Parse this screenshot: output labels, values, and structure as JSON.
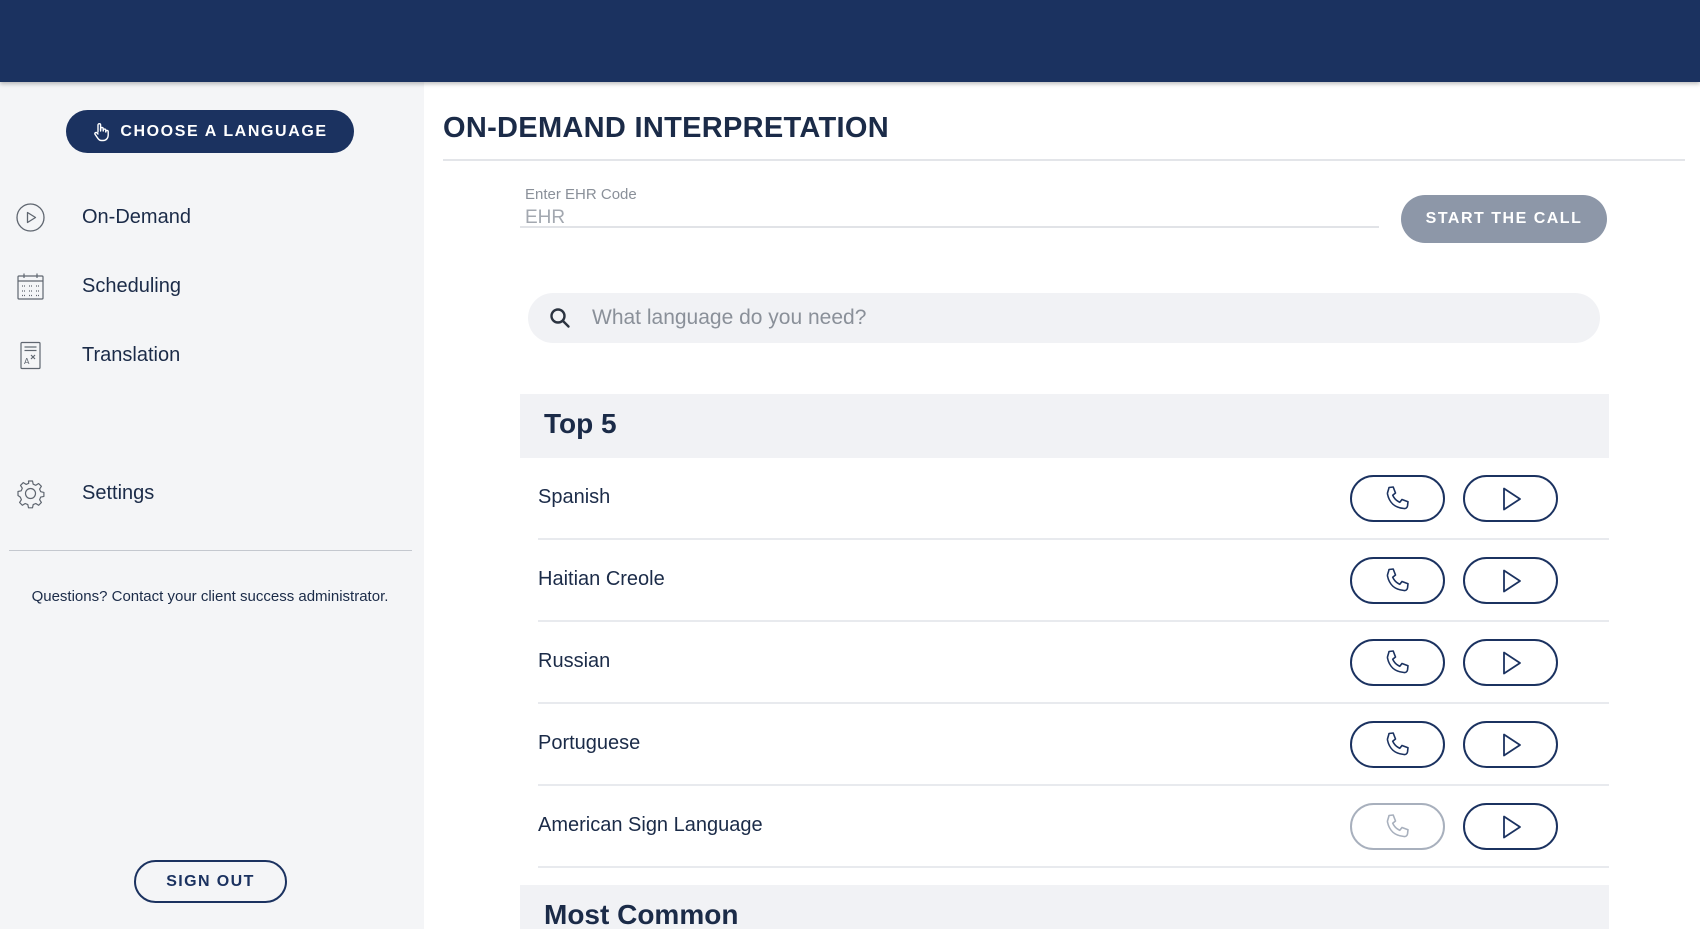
{
  "sidebar": {
    "choose_language_label": "CHOOSE A LANGUAGE",
    "nav": [
      {
        "label": "On-Demand",
        "icon": "play-circle-icon"
      },
      {
        "label": "Scheduling",
        "icon": "calendar-icon"
      },
      {
        "label": "Translation",
        "icon": "document-translate-icon"
      },
      {
        "label": "Settings",
        "icon": "gear-icon"
      }
    ],
    "questions_text": "Questions? Contact your client success administrator.",
    "sign_out_label": "SIGN OUT"
  },
  "main": {
    "title": "ON-DEMAND INTERPRETATION",
    "ehr": {
      "label": "Enter EHR Code",
      "placeholder": "EHR",
      "value": ""
    },
    "start_call_label": "START THE CALL",
    "search": {
      "placeholder": "What language do you need?",
      "value": ""
    },
    "sections": [
      {
        "title": "Top 5",
        "languages": [
          {
            "name": "Spanish",
            "audio_enabled": true,
            "video_enabled": true
          },
          {
            "name": "Haitian Creole",
            "audio_enabled": true,
            "video_enabled": true
          },
          {
            "name": "Russian",
            "audio_enabled": true,
            "video_enabled": true
          },
          {
            "name": "Portuguese",
            "audio_enabled": true,
            "video_enabled": true
          },
          {
            "name": "American Sign Language",
            "audio_enabled": false,
            "video_enabled": true
          }
        ]
      },
      {
        "title": "Most Common",
        "languages": []
      }
    ]
  },
  "colors": {
    "brand_navy": "#1b3260",
    "text_dark": "#1b2b48",
    "disabled_button": "#8d97a8",
    "sidebar_bg": "#f4f5f7",
    "section_bg": "#f1f2f5"
  }
}
